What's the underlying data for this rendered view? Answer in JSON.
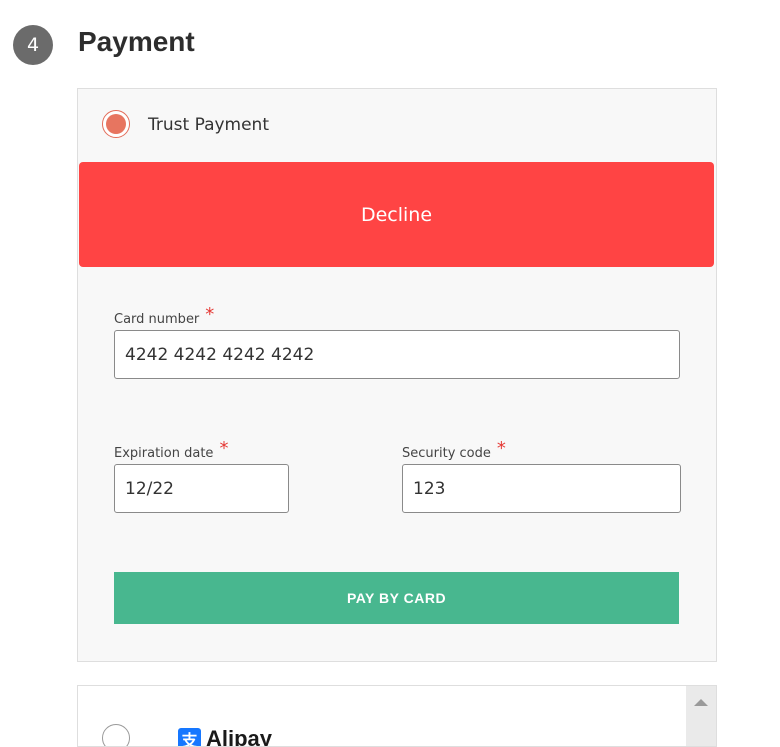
{
  "step": {
    "number": "4",
    "title": "Payment"
  },
  "trust_payment": {
    "label": "Trust Payment",
    "status_banner": "Decline",
    "card_number": {
      "label": "Card number",
      "required": "*",
      "value": "4242 4242 4242 4242"
    },
    "expiration_date": {
      "label": "Expiration date",
      "required": "*",
      "value": "12/22"
    },
    "security_code": {
      "label": "Security code",
      "required": "*",
      "value": "123"
    },
    "pay_button_label": "PAY BY CARD"
  },
  "alipay": {
    "label": "Alipay",
    "icon": "alipay-logo-icon"
  },
  "colors": {
    "decline": "#ff4444",
    "pay_button": "#48b78f",
    "radio_selected": "#e77560",
    "required_marker": "#e53935"
  }
}
